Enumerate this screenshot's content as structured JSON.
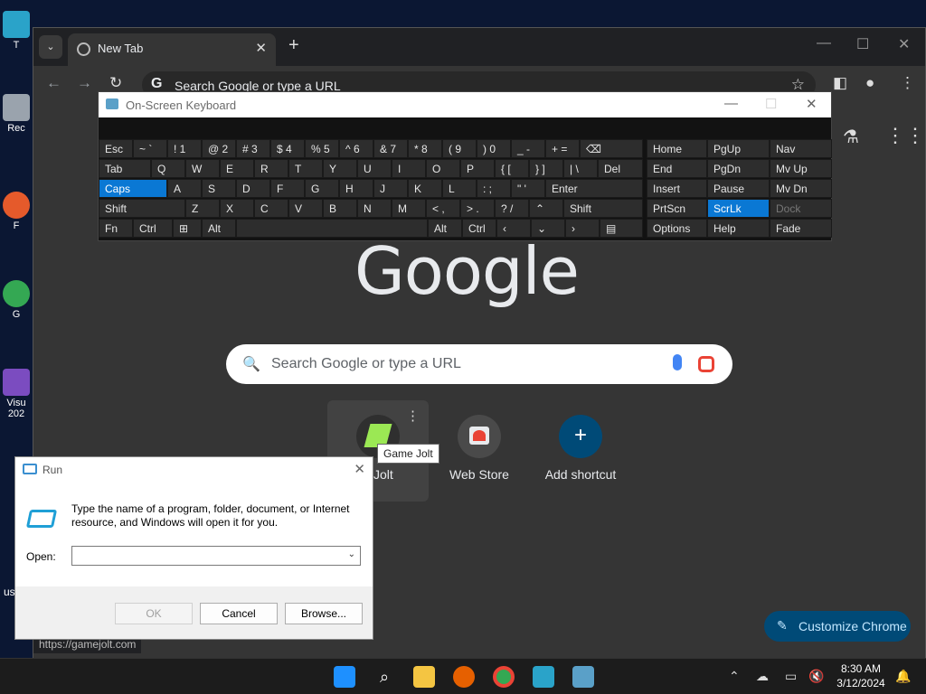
{
  "desktop": {
    "icon_labels": [
      "T",
      "Rec",
      "F",
      "G",
      "Visu",
      "202",
      "us"
    ]
  },
  "browser": {
    "tab_title": "New Tab",
    "omnibox_text": "Search Google or type a URL",
    "google_logo": "Google",
    "search_placeholder": "Search Google or type a URL",
    "shortcuts": [
      {
        "label": "e Jolt",
        "icon": "game-jolt-icon"
      },
      {
        "label": "Web Store",
        "icon": "web-store-icon"
      },
      {
        "label": "Add shortcut",
        "icon": "plus-icon"
      }
    ],
    "tooltip": "Game Jolt",
    "customize_label": "Customize Chrome",
    "status_url": "https://gamejolt.com"
  },
  "osk": {
    "title": "On-Screen Keyboard",
    "keys": {
      "esc": "Esc",
      "k1": "~ `",
      "k2": "! 1",
      "k3": "@ 2",
      "k4": "# 3",
      "k5": "$ 4",
      "k6": "% 5",
      "k7": "^ 6",
      "k8": "& 7",
      "k9": "* 8",
      "k10": "( 9",
      "k11": ") 0",
      "k12": "_ -",
      "k13": "+ =",
      "bksp": "⌫",
      "home": "Home",
      "pgup": "PgUp",
      "nav": "Nav",
      "tab": "Tab",
      "q": "Q",
      "w": "W",
      "e": "E",
      "r": "R",
      "t": "T",
      "y": "Y",
      "u": "U",
      "i": "I",
      "o": "O",
      "p": "P",
      "lbr": "{ [",
      "rbr": "} ]",
      "bsl": "| \\",
      "del": "Del",
      "end": "End",
      "pgdn": "PgDn",
      "mvup": "Mv Up",
      "caps": "Caps",
      "a": "A",
      "s": "S",
      "d": "D",
      "f": "F",
      "g": "G",
      "h": "H",
      "j": "J",
      "k": "K",
      "l": "L",
      "semi": ": ;",
      "quote": "\" '",
      "enter": "Enter",
      "insert": "Insert",
      "pause": "Pause",
      "mvdn": "Mv Dn",
      "shift": "Shift",
      "z": "Z",
      "x": "X",
      "c": "C",
      "v": "V",
      "b": "B",
      "n": "N",
      "m": "M",
      "comma": "< ,",
      "period": "> .",
      "slash": "? /",
      "up": "⌃",
      "shift2": "Shift",
      "prtscn": "PrtScn",
      "scrlk": "ScrLk",
      "dock": "Dock",
      "fn": "Fn",
      "ctrl": "Ctrl",
      "win": "⊞",
      "alt": "Alt",
      "space": "",
      "alt2": "Alt",
      "ctrl2": "Ctrl",
      "left": "‹",
      "down": "⌄",
      "right": "›",
      "menu": "▤",
      "options": "Options",
      "help": "Help",
      "fade": "Fade"
    }
  },
  "run": {
    "title": "Run",
    "description": "Type the name of a program, folder, document, or Internet resource, and Windows will open it for you.",
    "open_label": "Open:",
    "open_value": "",
    "ok": "OK",
    "cancel": "Cancel",
    "browse": "Browse..."
  },
  "taskbar": {
    "time": "8:30 AM",
    "date": "3/12/2024"
  },
  "colors": {
    "accent": "#0a78d4",
    "customize_bg": "#004a77"
  }
}
